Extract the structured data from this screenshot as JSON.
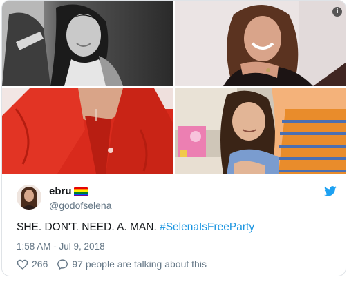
{
  "author": {
    "name": "ebru",
    "handle": "@godofselena",
    "flag_colors": [
      "#e40303",
      "#ff8c00",
      "#ffed00",
      "#008026",
      "#004dff",
      "#750787"
    ]
  },
  "tweet": {
    "text": "SHE. DON'T. NEED. A. MAN. ",
    "hashtag": "#SelenaIsFreeParty",
    "timestamp": "1:58 AM - Jul 9, 2018"
  },
  "actions": {
    "like_count": "266",
    "talking_text": "97 people are talking about this"
  },
  "media": {
    "info_label": "i"
  },
  "colors": {
    "link": "#1b95e0",
    "muted": "#657786",
    "text": "#14171a",
    "twitter_blue": "#1da1f2"
  }
}
